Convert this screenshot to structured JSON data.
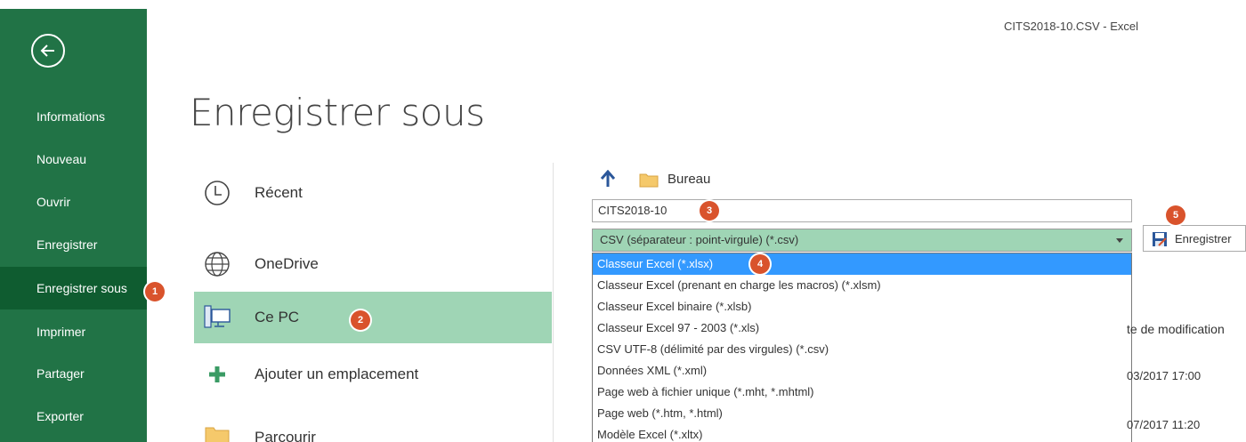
{
  "window": {
    "title": "CITS2018-10.CSV  -  Excel"
  },
  "sidebar": {
    "items": [
      {
        "label": "Informations"
      },
      {
        "label": "Nouveau"
      },
      {
        "label": "Ouvrir"
      },
      {
        "label": "Enregistrer"
      },
      {
        "label": "Enregistrer sous"
      },
      {
        "label": "Imprimer"
      },
      {
        "label": "Partager"
      },
      {
        "label": "Exporter"
      }
    ],
    "active": "Enregistrer sous"
  },
  "page": {
    "title": "Enregistrer sous"
  },
  "locations": [
    {
      "label": "Récent",
      "icon": "clock-icon"
    },
    {
      "label": "OneDrive",
      "icon": "globe-icon"
    },
    {
      "label": "Ce PC",
      "icon": "computer-icon"
    },
    {
      "label": "Ajouter un emplacement",
      "icon": "plus-icon"
    },
    {
      "label": "Parcourir",
      "icon": "folder-icon"
    }
  ],
  "save_panel": {
    "path": "Bureau",
    "filename": "CITS2018-10",
    "file_type": "CSV (séparateur : point-virgule) (*.csv)",
    "file_type_options": [
      "Classeur Excel (*.xlsx)",
      "Classeur Excel (prenant en charge les macros) (*.xlsm)",
      "Classeur Excel binaire (*.xlsb)",
      "Classeur Excel 97 - 2003 (*.xls)",
      "CSV UTF-8 (délimité par des virgules) (*.csv)",
      "Données XML (*.xml)",
      "Page web à fichier unique (*.mht, *.mhtml)",
      "Page web (*.htm, *.html)",
      "Modèle Excel (*.xltx)"
    ],
    "selected_option": "Classeur Excel (*.xlsx)",
    "save_button": "Enregistrer",
    "column_header": "te de modification",
    "dates": [
      "03/2017 17:00",
      "07/2017 11:20"
    ]
  },
  "badges": [
    "1",
    "2",
    "3",
    "4",
    "5"
  ],
  "colors": {
    "sidebar": "#217346",
    "sidebar_active": "#0f5c30",
    "highlight": "#9fd5b5",
    "selection": "#3399ff",
    "badge": "#d9532c"
  }
}
